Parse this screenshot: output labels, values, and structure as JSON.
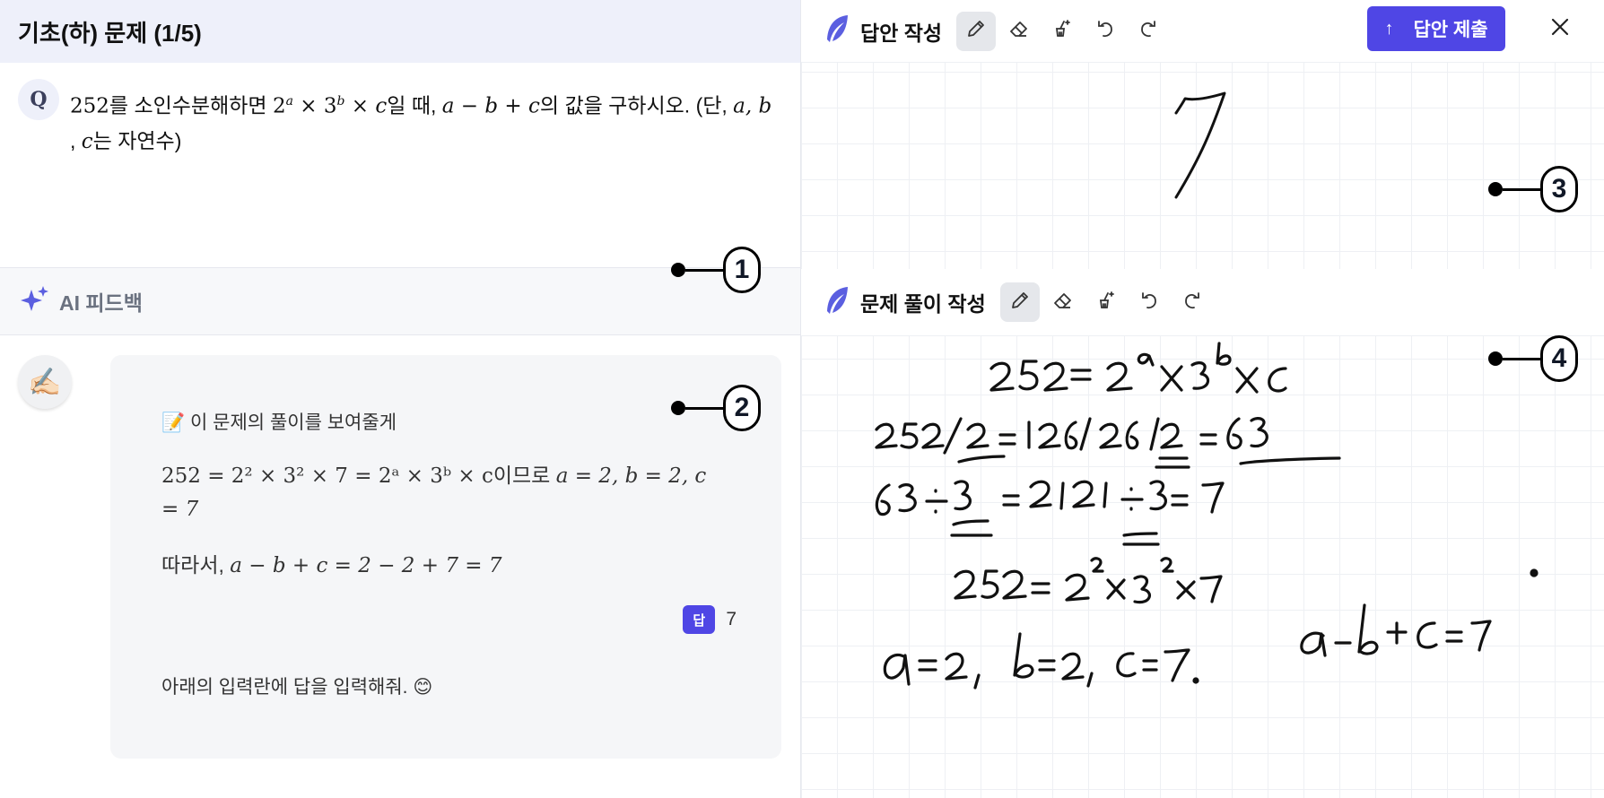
{
  "question": {
    "header": "기초(하) 문제 (1/5)",
    "badge": "Q",
    "prefix_num": "252",
    "text1": "를 소인수분해하면 ",
    "expr_base_2": "2",
    "exp_a": "a",
    "times1": " × ",
    "expr_base_3": "3",
    "exp_b": "b",
    "times2": " × ",
    "var_c": "c",
    "text2": "일 때, ",
    "expr2": "a − b + c",
    "text3": "의 값을 구하시오. (단, ",
    "vars": "a, b",
    "text4": ", ",
    "var_c2": "c",
    "text5": "는 자연수)"
  },
  "ai_feedback": {
    "title": "AI 피드백",
    "avatar": "✍🏻",
    "intro_emoji": "📝",
    "intro": " 이 문제의 풀이를 보여줄게",
    "step1_math": "252 = 2² × 3² × 7 = 2ᵃ × 3ᵇ × c",
    "step1_text": "이므로 ",
    "step1_vals": "a = 2, b = 2, c = 7",
    "step2_text": "따라서, ",
    "step2_math": "a − b + c = 2 − 2 + 7 = 7",
    "answer_badge": "답",
    "answer_value": "7",
    "outro": "아래의 입력란에 답을 입력해줘. 😊"
  },
  "answer_panel": {
    "title": "답안 작성",
    "submit_label": "답안 제출",
    "submit_icon": "↑",
    "tools": [
      "pen-icon",
      "eraser-icon",
      "clear-brush-icon",
      "undo-icon",
      "redo-icon"
    ]
  },
  "solution_panel": {
    "title": "문제 풀이 작성",
    "tools": [
      "pen-icon",
      "eraser-icon",
      "clear-brush-icon",
      "undo-icon",
      "redo-icon"
    ]
  },
  "callouts": [
    "1",
    "2",
    "3",
    "4"
  ],
  "colors": {
    "accent": "#4f46e5",
    "header_bg": "#eef0fa",
    "bubble_bg": "#f5f6f8"
  }
}
